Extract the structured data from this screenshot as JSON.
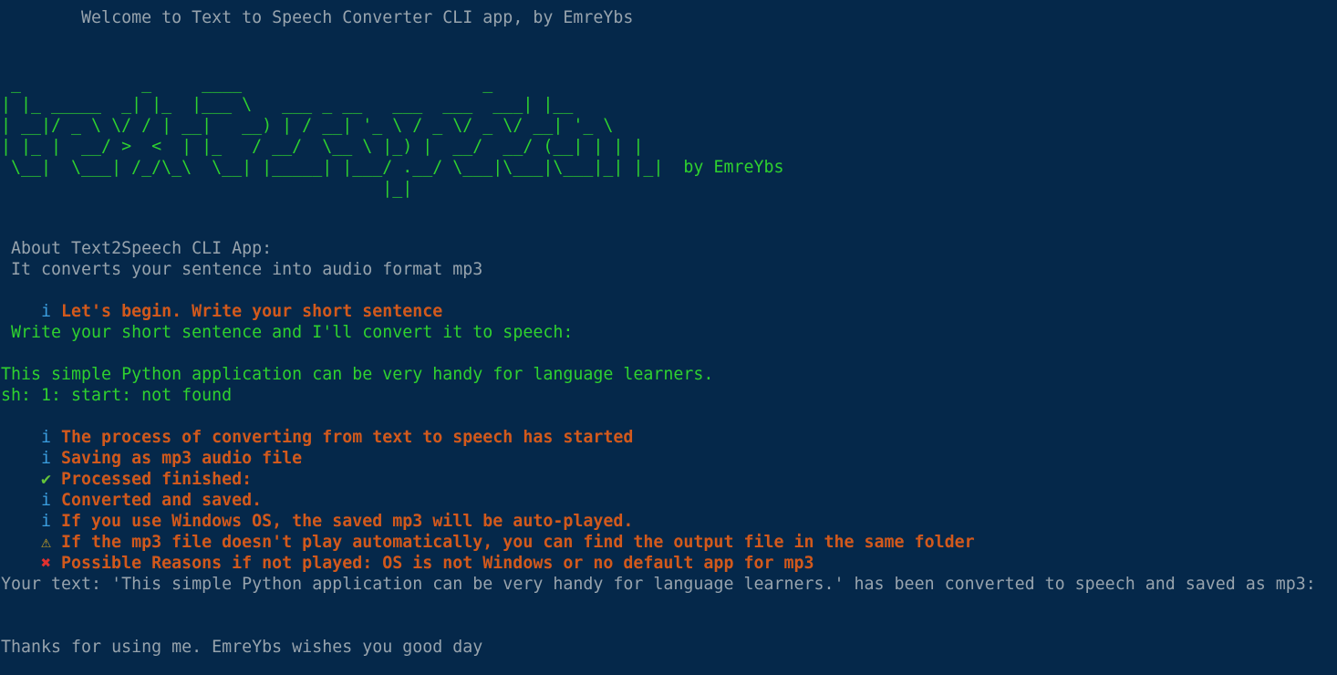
{
  "window": {
    "welcome": "        Welcome to Text to Speech Converter CLI app, by EmreYbs"
  },
  "banner": {
    "ascii_lines": [
      " _            _     ____                        _",
      "| |_ _____  _| |_  |___ \\   ___ _ __   ___  ___  ___| |__",
      "| __|/ _ \\ \\/ / | __|   __) | / __| '_ \\ / _ \\/ _ \\/ __| '_ \\",
      "| |_ |  __/ >  <  | |_   / __/  \\__ \\ |_) |  __/  __/ (__| | | |",
      " \\__|  \\___| /_/\\_\\  \\__| |_____| |___/ .__/ \\___|\\___|\\___|_| |_|  by EmreYbs",
      "                                      |_|"
    ],
    "author_label": "by EmreYbs"
  },
  "about": {
    "title": " About Text2Speech CLI App:",
    "description": " It converts your sentence into audio format mp3"
  },
  "prompt": {
    "begin_icon": "i",
    "begin_text": "Let's begin. Write your short sentence",
    "instruction": " Write your short sentence and I'll convert it to speech:",
    "user_input": "This simple Python application can be very handy for language learners.",
    "shell_error": "sh: 1: start: not found"
  },
  "log": [
    {
      "icon": "i",
      "kind": "info",
      "text": "The process of converting from text to speech has started"
    },
    {
      "icon": "i",
      "kind": "info",
      "text": "Saving as mp3 audio file"
    },
    {
      "icon": "✔",
      "kind": "success",
      "text": "Processed finished:"
    },
    {
      "icon": "i",
      "kind": "info",
      "text": "Converted and saved."
    },
    {
      "icon": "i",
      "kind": "info",
      "text": "If you use Windows OS, the saved mp3 will be auto-played."
    },
    {
      "icon": "⚠",
      "kind": "warning",
      "text": "If the mp3 file doesn't play automatically, you can find the output file in the same folder"
    },
    {
      "icon": "✖",
      "kind": "error",
      "text": "Possible Reasons if not played: OS is not Windows or no default app for mp3"
    }
  ],
  "result": {
    "summary": "Your text: 'This simple Python application can be very handy for language learners.' has been converted to speech and saved as mp3:"
  },
  "footer": {
    "goodbye": "Thanks for using me. EmreYbs wishes you good day"
  },
  "colors": {
    "background": "#05284a",
    "text_gray": "#97a3ad",
    "text_green": "#2fd12f",
    "text_orange": "#d2591c",
    "info_icon": "#3b9fe0",
    "success_icon": "#64c43a",
    "warning_icon": "#c9a227",
    "error_icon": "#e0312f"
  }
}
